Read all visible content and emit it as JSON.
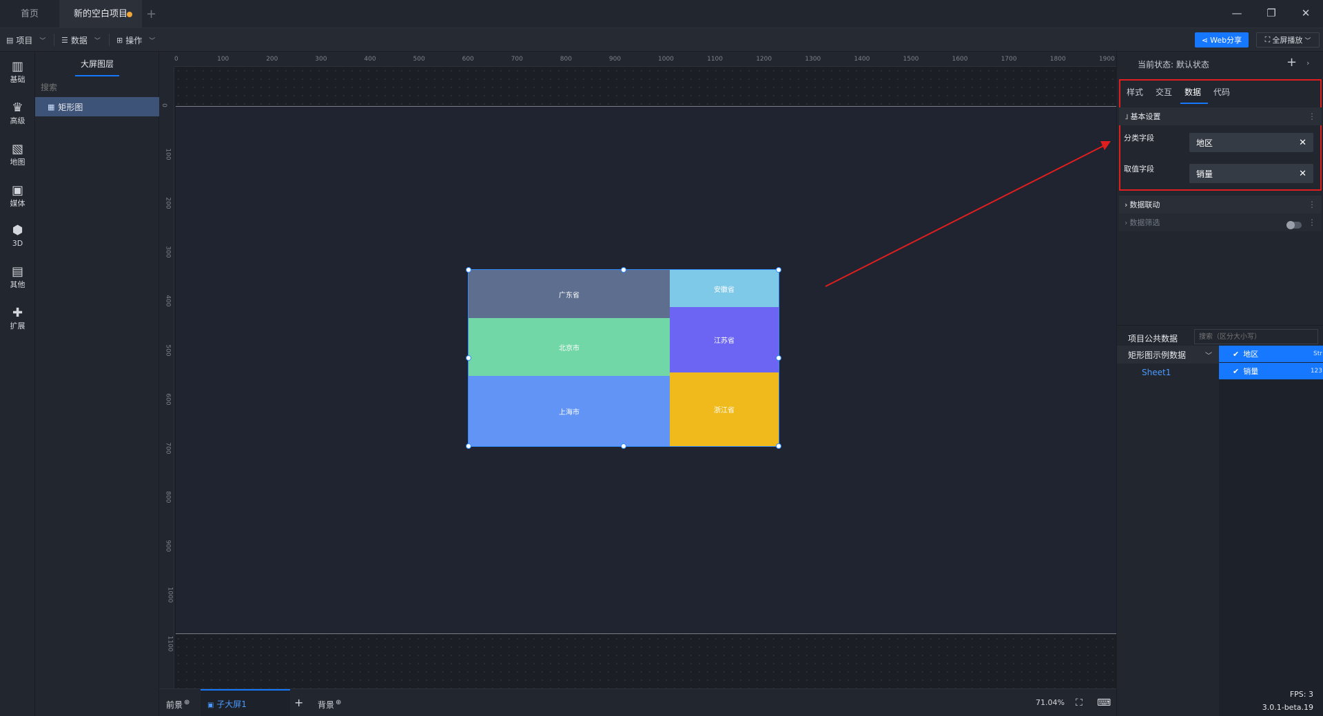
{
  "tabs": {
    "home": "首页",
    "project": "新的空白项目",
    "add": "+"
  },
  "window": {
    "minimize": "—",
    "restore": "❐",
    "close": "✕"
  },
  "menubar": {
    "project": "项目",
    "data": "数据",
    "operate": "操作",
    "share": "Web分享",
    "fullscreen": "全屏播放"
  },
  "iconbar": [
    {
      "name": "basic",
      "label": "基础",
      "icon": "bar-chart-icon",
      "glyph": "▥"
    },
    {
      "name": "advanced",
      "label": "高级",
      "icon": "crown-icon",
      "glyph": "♛"
    },
    {
      "name": "map",
      "label": "地图",
      "icon": "map-icon",
      "glyph": "▧"
    },
    {
      "name": "media",
      "label": "媒体",
      "icon": "media-icon",
      "glyph": "▣"
    },
    {
      "name": "3d",
      "label": "3D",
      "icon": "cube-icon",
      "glyph": "⬢"
    },
    {
      "name": "other",
      "label": "其他",
      "icon": "list-icon",
      "glyph": "▤"
    },
    {
      "name": "extend",
      "label": "扩展",
      "icon": "puzzle-icon",
      "glyph": "✚"
    }
  ],
  "layers": {
    "title": "大屏图层",
    "search_placeholder": "搜索",
    "item": "矩形图"
  },
  "ruler": {
    "x": [
      "0",
      "100",
      "200",
      "300",
      "400",
      "500",
      "600",
      "700",
      "800",
      "900",
      "1000",
      "1100",
      "1200",
      "1300",
      "1400",
      "1500",
      "1600",
      "1700",
      "1800",
      "1900"
    ],
    "y": [
      "0",
      "100",
      "200",
      "300",
      "400",
      "500",
      "600",
      "700",
      "800",
      "900",
      "1000",
      "1100"
    ]
  },
  "chart_data": {
    "type": "treemap",
    "items": [
      {
        "name": "广东省",
        "color": "#5d6e8f"
      },
      {
        "name": "北京市",
        "color": "#72d7a6"
      },
      {
        "name": "上海市",
        "color": "#6294f6"
      },
      {
        "name": "安徽省",
        "color": "#7ec8e8"
      },
      {
        "name": "江苏省",
        "color": "#6c65f4"
      },
      {
        "name": "浙江省",
        "color": "#f0b91c"
      }
    ]
  },
  "bottombar": {
    "foreground": "前景",
    "screen": "子大屏1",
    "background": "背景",
    "zoom": "71.04%"
  },
  "rightpanel": {
    "state_label": "当前状态:",
    "state_value": "默认状态",
    "tabs": [
      "样式",
      "交互",
      "数据",
      "代码"
    ],
    "basic_settings": "基本设置",
    "category_label": "分类字段",
    "category_value": "地区",
    "value_label": "取值字段",
    "value_value": "销量",
    "data_link": "数据联动",
    "data_filter": "数据筛选",
    "public_data_title": "项目公共数据",
    "public_search_placeholder": "搜索（区分大小写）",
    "dataset": "矩形图示例数据",
    "sheet": "Sheet1",
    "fields": [
      {
        "name": "地区",
        "type": "Str"
      },
      {
        "name": "销量",
        "type": "123"
      }
    ]
  },
  "status": {
    "fps": "FPS: 3",
    "version": "3.0.1-beta.19"
  },
  "colors": {
    "accent": "#1677ff",
    "annotation": "#e01e1e"
  }
}
